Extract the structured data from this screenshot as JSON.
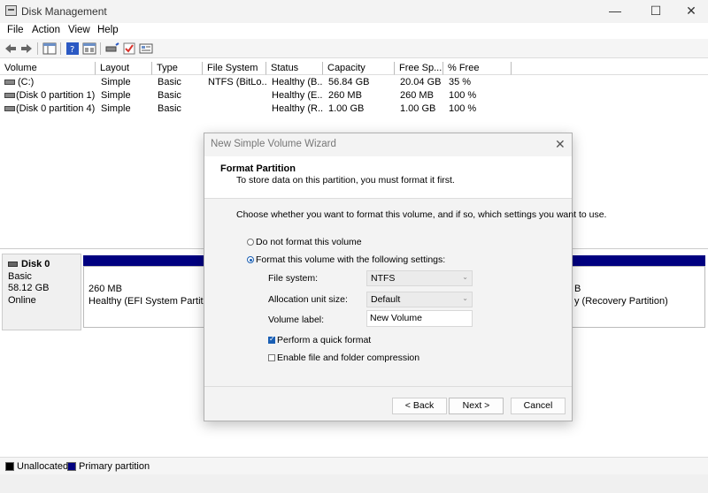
{
  "window": {
    "title": "Disk Management",
    "minimize": "—",
    "maximize": "☐",
    "close": "✕"
  },
  "menu": [
    "File",
    "Action",
    "View",
    "Help"
  ],
  "toolbar": {
    "icons": [
      "back-arrow-icon",
      "forward-arrow-icon",
      "console-tree-icon",
      "help-icon",
      "properties-icon",
      "connect-drive-icon",
      "check-icon",
      "settings-icon"
    ]
  },
  "volumes": {
    "headers": [
      "Volume",
      "Layout",
      "Type",
      "File System",
      "Status",
      "Capacity",
      "Free Sp...",
      "% Free"
    ],
    "rows": [
      [
        "(C:)",
        "Simple",
        "Basic",
        "NTFS (BitLo...",
        "Healthy (B...",
        "56.84 GB",
        "20.04 GB",
        "35 %"
      ],
      [
        "(Disk 0 partition 1)",
        "Simple",
        "Basic",
        "",
        "Healthy (E...",
        "260 MB",
        "260 MB",
        "100 %"
      ],
      [
        "(Disk 0 partition 4)",
        "Simple",
        "Basic",
        "",
        "Healthy (R...",
        "1.00 GB",
        "1.00 GB",
        "100 %"
      ]
    ]
  },
  "disk": {
    "name": "Disk 0",
    "type": "Basic",
    "size": "58.12 GB",
    "status": "Online",
    "partitions": [
      {
        "size": "260 MB",
        "status": "Healthy (EFI System Partition)"
      },
      {
        "size": "B",
        "status": "y (Recovery Partition)"
      }
    ]
  },
  "legend": {
    "unallocated": "Unallocated",
    "primary": "Primary partition",
    "colors": {
      "unallocated": "#000000",
      "primary": "#000080"
    }
  },
  "dialog": {
    "title": "New Simple Volume Wizard",
    "close": "✕",
    "heading": "Format Partition",
    "subheading": "To store data on this partition, you must format it first.",
    "intro": "Choose whether you want to format this volume, and if so, which settings you want to use.",
    "option_no_format": "Do not format this volume",
    "option_format": "Format this volume with the following settings:",
    "selected_option": "format",
    "file_system_label": "File system:",
    "file_system_value": "NTFS",
    "alloc_label": "Allocation unit size:",
    "alloc_value": "Default",
    "volume_label_label": "Volume label:",
    "volume_label_value": "New Volume",
    "quick_format_label": "Perform a quick format",
    "quick_format_checked": true,
    "compression_label": "Enable file and folder compression",
    "compression_checked": false,
    "back_button": "< Back",
    "next_button": "Next >",
    "cancel_button": "Cancel"
  }
}
